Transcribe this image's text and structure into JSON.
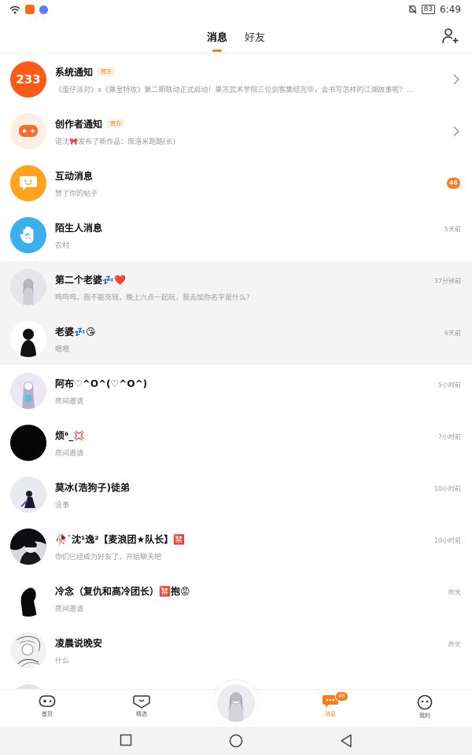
{
  "status_bar": {
    "app_icon_text": "谐",
    "battery": "83",
    "time": "6:49",
    "icons": [
      "wifi-icon",
      "app-icon",
      "chat-app-icon",
      "mute-bell-icon",
      "battery-icon"
    ]
  },
  "header": {
    "tabs": [
      {
        "label": "消息",
        "active": true
      },
      {
        "label": "好友",
        "active": false
      }
    ],
    "add_friend_icon": "add-user-icon"
  },
  "colors": {
    "accent": "#ff7a1a",
    "row_shaded": "#f4f4f5",
    "muted_text": "#9a9a9a",
    "interaction_avatar": "#ffa41f",
    "stranger_avatar": "#3ab0f0"
  },
  "messages": [
    {
      "name": "系统通知",
      "official": "官方",
      "preview": "《蛋仔派对》x《果宝特攻》第二期联动正式启动！果冻武术学院三位剑客集结完毕，会书写怎样的江湖故事呢？陆小果、花如意、...",
      "time": "",
      "trailing": "chevron",
      "avatar": "233-logo",
      "avatar_text": "233"
    },
    {
      "name": "创作者通知",
      "official": "官方",
      "preview": "诺沈🎀发布了新作品：库洛米跑酷(长)",
      "time": "",
      "trailing": "chevron",
      "avatar": "gamepad-plus-icon"
    },
    {
      "name": "互动消息",
      "official": "",
      "preview": "赞了你的帖子",
      "time": "",
      "trailing": "count",
      "count": "46",
      "avatar": "chat-bubble-smile-icon"
    },
    {
      "name": "陌生人消息",
      "official": "",
      "preview": "农村",
      "time": "5天前",
      "trailing": "time",
      "avatar": "wave-hand-icon"
    },
    {
      "name": "第二个老婆💤❤️",
      "official": "",
      "preview": "呜呜呜，我不能充钱，晚上六点一起玩，我去加你名字是什么？",
      "time": "37分钟前",
      "trailing": "time",
      "avatar": "anime-girl-avatar",
      "shaded": true
    },
    {
      "name": "老婆💤😘",
      "official": "",
      "preview": "嗯嗯",
      "time": "6天前",
      "trailing": "time",
      "avatar": "silhouette-avatar",
      "shaded": true
    },
    {
      "name": "阿布♡^O^(♡^O^)",
      "official": "",
      "preview": "房间邀请",
      "time": "5小时前",
      "trailing": "time",
      "avatar": "anime-girl-avatar"
    },
    {
      "name": "烦⁶_💢",
      "official": "",
      "preview": "房间邀请",
      "time": "7小时前",
      "trailing": "time",
      "avatar": "black-avatar"
    },
    {
      "name": "莫冰(浩狗子)徒弟",
      "official": "",
      "preview": "没事",
      "time": "10小时前",
      "trailing": "time",
      "avatar": "anime-figure-avatar"
    },
    {
      "name": "🥀˙沈¹逸²【麦浪团★队长】🈲",
      "official": "",
      "preview": "你们已经成为好友了，开始聊天吧",
      "time": "10小时前",
      "trailing": "time",
      "avatar": "dark-hair-avatar"
    },
    {
      "name": "冷念（复仇和高冷团长）🈲抱😡",
      "official": "",
      "preview": "房间邀请",
      "time": "昨天",
      "trailing": "time",
      "avatar": "silhouette-avatar"
    },
    {
      "name": "凌晨说晚安",
      "official": "",
      "preview": "什么",
      "time": "昨天",
      "trailing": "time",
      "avatar": "sketch-avatar"
    }
  ],
  "bottom_nav": [
    {
      "label": "首页",
      "icon": "gamepad-icon",
      "active": false
    },
    {
      "label": "精选",
      "icon": "heart-chat-icon",
      "active": false
    },
    {
      "label": "消息",
      "icon": "message-icon",
      "active": true,
      "count": "46"
    },
    {
      "label": "我的",
      "icon": "face-icon",
      "active": false
    }
  ],
  "system_nav": [
    "square-icon",
    "circle-icon",
    "back-triangle-icon"
  ]
}
